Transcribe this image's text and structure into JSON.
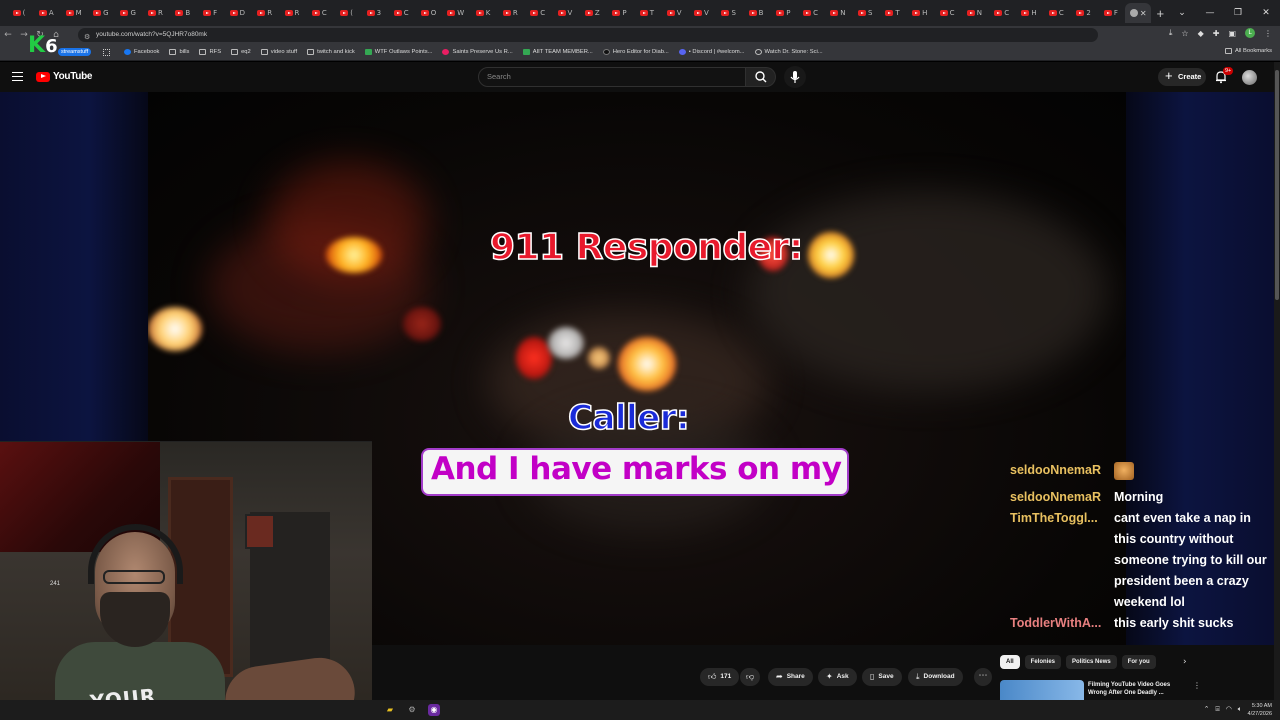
{
  "browser": {
    "tabs": [
      "(",
      "A",
      "M",
      "G",
      "G",
      "R",
      "B",
      "F",
      "D",
      "R",
      "R",
      "C",
      "(",
      "3",
      "C",
      "O",
      "W",
      "K",
      "R",
      "C",
      "V",
      "Z",
      "P",
      "T",
      "V",
      "V",
      "S",
      "B",
      "P",
      "C",
      "N",
      "S",
      "T",
      "H",
      "C",
      "N",
      "C",
      "H",
      "C",
      "2",
      "F"
    ],
    "url": "youtube.com/watch?v=5QJHR7o80mk",
    "bookmarks": [
      {
        "label": "Facebook",
        "icon": "facebook-icon"
      },
      {
        "label": "bills",
        "icon": "folder-icon"
      },
      {
        "label": "RFS",
        "icon": "folder-icon"
      },
      {
        "label": "eq2",
        "icon": "folder-icon"
      },
      {
        "label": "video stuff",
        "icon": "folder-icon"
      },
      {
        "label": "twitch and kick",
        "icon": "folder-icon"
      },
      {
        "label": "WTF Outlaws Points...",
        "icon": "plus-icon"
      },
      {
        "label": "Saints Preserve Us R...",
        "icon": "saints-icon"
      },
      {
        "label": "AIIT TEAM MEMBER...",
        "icon": "plus-icon"
      },
      {
        "label": "Hero Editor for Diab...",
        "icon": "hero-editor-icon"
      },
      {
        "label": "• Discord | #welcom...",
        "icon": "discord-icon"
      },
      {
        "label": "Watch Dr. Stone: Sci...",
        "icon": "globe-icon"
      }
    ],
    "all_bookmarks": "All Bookmarks",
    "stream_overlay": {
      "logo": "K",
      "count": "6",
      "tag": "streamstuff"
    }
  },
  "youtube": {
    "logo_text": "YouTube",
    "search_placeholder": "Search",
    "create_label": "Create",
    "notifications": "9+"
  },
  "video": {
    "caption_responder": "911 Responder:",
    "caption_caller": "Caller:",
    "caption_line": "And I have marks on my"
  },
  "chat": [
    {
      "user": "seldooNnemaR",
      "message": "",
      "emote": true,
      "color": "#e8c060"
    },
    {
      "user": "seldooNnemaR",
      "message": "Morning",
      "emote": false,
      "color": "#e8c060"
    },
    {
      "user": "TimTheToggl...",
      "message": "cant even take a nap in this country without someone trying to kill our president been a crazy weekend lol",
      "emote": false,
      "color": "#e8c060"
    },
    {
      "user": "ToddlerWithA...",
      "message": "this early shit sucks",
      "emote": false,
      "color": "#e88080"
    }
  ],
  "webcam": {
    "shirt_text": "YOUR",
    "meter": "241"
  },
  "actions": {
    "likes": "171",
    "share": "Share",
    "ask": "Ask",
    "save": "Save",
    "download": "Download"
  },
  "chips": [
    "All",
    "Felonies",
    "Politics News",
    "For you"
  ],
  "recommendation": {
    "title": "Filming YouTube Video Goes Wrong After One Deadly ..."
  },
  "taskbar": {
    "time": "5:30 AM",
    "date": "4/27/2026"
  }
}
